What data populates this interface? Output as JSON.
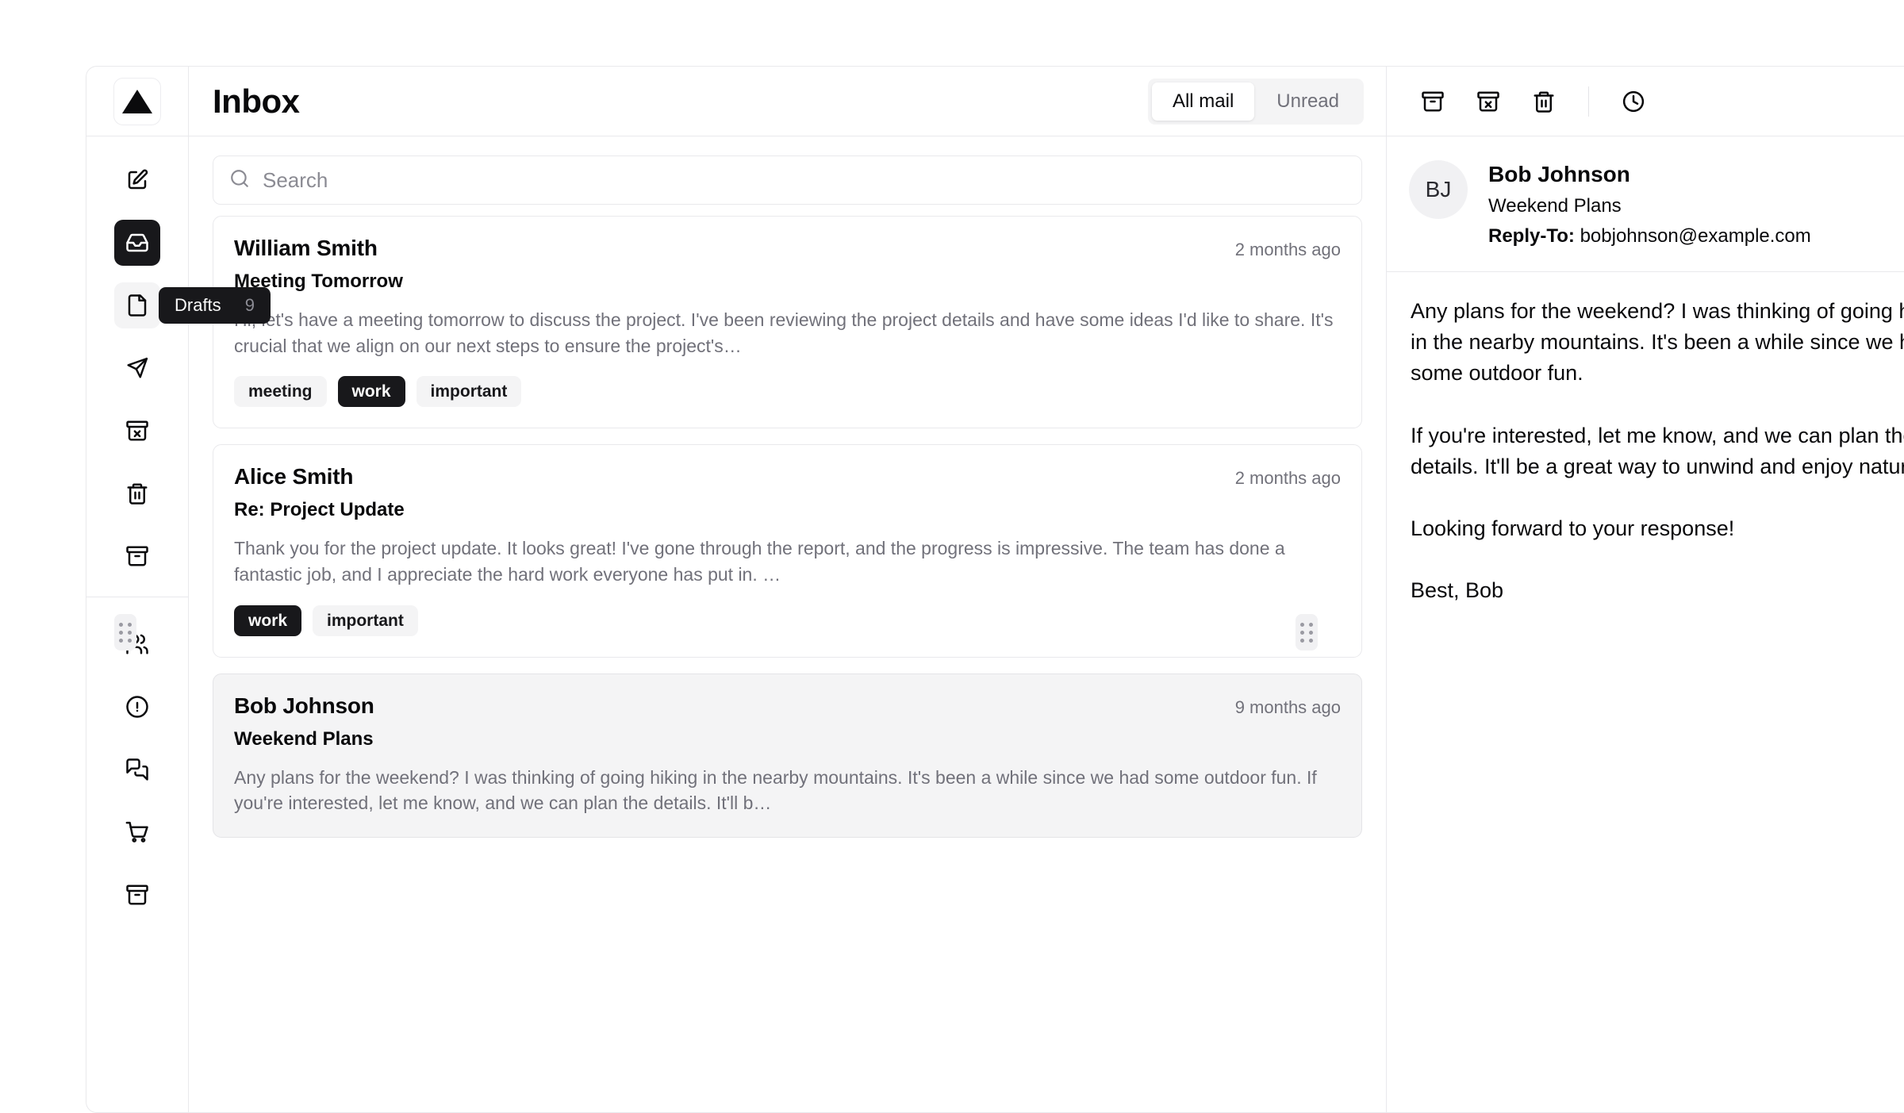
{
  "app": {
    "logo_icon": "triangle-logo-icon"
  },
  "rail": {
    "primary_items": [
      {
        "icon": "compose-icon",
        "name": "compose",
        "state": "default"
      },
      {
        "icon": "inbox-icon",
        "name": "inbox",
        "state": "active"
      },
      {
        "icon": "file-icon",
        "name": "drafts",
        "state": "hover"
      },
      {
        "icon": "send-icon",
        "name": "sent",
        "state": "default"
      },
      {
        "icon": "archive-x-icon",
        "name": "junk",
        "state": "default"
      },
      {
        "icon": "trash-icon",
        "name": "trash",
        "state": "default"
      },
      {
        "icon": "archive-icon",
        "name": "archive",
        "state": "default"
      }
    ],
    "secondary_items": [
      {
        "icon": "users-icon",
        "name": "social",
        "state": "default"
      },
      {
        "icon": "alert-circle-icon",
        "name": "updates",
        "state": "default"
      },
      {
        "icon": "messages-square-icon",
        "name": "forums",
        "state": "default"
      },
      {
        "icon": "shopping-cart-icon",
        "name": "shopping",
        "state": "default"
      },
      {
        "icon": "archive-icon",
        "name": "promotions",
        "state": "default"
      }
    ],
    "tooltip": {
      "label": "Drafts",
      "count": "9"
    }
  },
  "list": {
    "title": "Inbox",
    "tabs": [
      {
        "label": "All mail",
        "active": true
      },
      {
        "label": "Unread",
        "active": false
      }
    ],
    "search": {
      "placeholder": "Search",
      "value": "",
      "icon": "search-icon"
    },
    "emails": [
      {
        "name": "William Smith",
        "time": "2 months ago",
        "subject": "Meeting Tomorrow",
        "preview": "Hi, let's have a meeting tomorrow to discuss the project. I've been reviewing the project details and have some ideas I'd like to share. It's crucial that we align on our next steps to ensure the project's…",
        "tags": [
          {
            "label": "meeting",
            "solid": false
          },
          {
            "label": "work",
            "solid": true
          },
          {
            "label": "important",
            "solid": false
          }
        ],
        "selected": false
      },
      {
        "name": "Alice Smith",
        "time": "2 months ago",
        "subject": "Re: Project Update",
        "preview": "Thank you for the project update. It looks great! I've gone through the report, and the progress is impressive. The team has done a fantastic job, and I appreciate the hard work everyone has put in. …",
        "tags": [
          {
            "label": "work",
            "solid": true
          },
          {
            "label": "important",
            "solid": false
          }
        ],
        "selected": false
      },
      {
        "name": "Bob Johnson",
        "time": "9 months ago",
        "subject": "Weekend Plans",
        "preview": "Any plans for the weekend? I was thinking of going hiking in the nearby mountains. It's been a while since we had some outdoor fun. If you're interested, let me know, and we can plan the details. It'll b…",
        "tags": [],
        "selected": true
      }
    ]
  },
  "reader": {
    "toolbar": [
      {
        "icon": "archive-icon",
        "name": "archive"
      },
      {
        "icon": "archive-x-icon",
        "name": "move-to-junk"
      },
      {
        "icon": "trash-icon",
        "name": "move-to-trash"
      },
      {
        "icon": "clock-icon",
        "name": "snooze"
      }
    ],
    "avatar_initials": "BJ",
    "name": "Bob Johnson",
    "subject": "Weekend Plans",
    "reply_to_label": "Reply-To:",
    "reply_to_value": "bobjohnson@example.com",
    "body": "Any plans for the weekend? I was thinking of going hiking in the nearby mountains. It's been a while since we had some outdoor fun.\n\nIf you're interested, let me know, and we can plan the details. It'll be a great way to unwind and enjoy nature.\n\nLooking forward to your response!\n\nBest, Bob"
  },
  "colors": {
    "accent": "#18181b",
    "muted_text": "#71717a",
    "border": "#e9e9ec",
    "selected_bg": "#f4f4f5"
  }
}
